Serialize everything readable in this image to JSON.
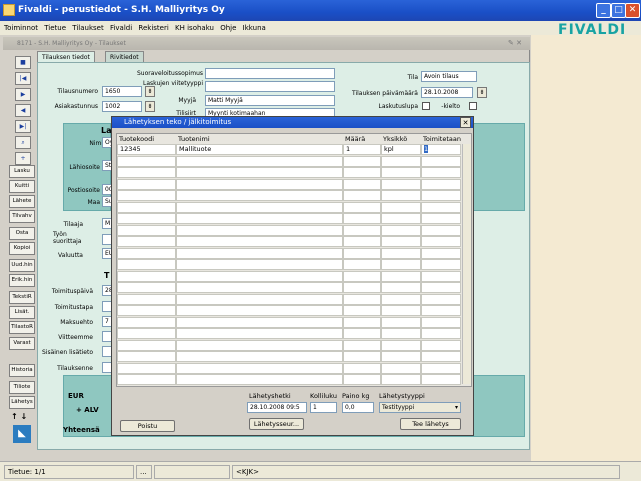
{
  "window": {
    "title": "Fivaldi - perustiedot - S.H. Malliyritys Oy"
  },
  "logo": "FIVALDI",
  "menu": [
    "Toiminnot",
    "Tietue",
    "Tilaukset",
    "Fivaldi",
    "Rekisteri",
    "KH isohaku",
    "Ohje",
    "Ikkuna"
  ],
  "inner_window": {
    "title": "8171 - S.H. Malliyritys Oy - Tilaukset"
  },
  "tabs": [
    "Tilauksen tiedot",
    "Rivitiedot"
  ],
  "side_buttons": [
    "Lasku",
    "Kuitti",
    "Lähete",
    "Tilvahv",
    "Osta",
    "Kopioi",
    "Uud.hin",
    "Erik.hin",
    "TekstiR",
    "Lisät.",
    "TilastoR",
    "Varast",
    "Historia",
    "Tiliote",
    "Lähetys"
  ],
  "form": {
    "suoraveloitussopimus_label": "Suoraveloitussopimus",
    "laskujen_viitetyyppi_label": "Laskujen viitetyyppi",
    "myyja_label": "Myyjä",
    "myyja_value": "Matti Myyjä",
    "tilisiirt_label": "Tilisiirt",
    "tilisiirt_value": "Myynti kotimaahan",
    "tilausnumero_label": "Tilausnumero",
    "tilausnumero_value": "1650",
    "asiakastunnus_label": "Asiakastunnus",
    "asiakastunnus_value": "1002",
    "tila_label": "Tila",
    "tila_value": "Avoin tilaus",
    "tilauksen_pvm_label": "Tilauksen päivämäärä",
    "tilauksen_pvm_value": "28.10.2008",
    "laskutuslupa_label": "Laskutuslupa",
    "kielto_label": "-kielto",
    "nimi_label": "Nimi",
    "nimi_value": "Oy",
    "lahiosoite_label": "Lähiosoite",
    "lahiosoite_value": "St",
    "postiosoite_label": "Postiosoite",
    "postiosoite_value": "00",
    "maa_label": "Maa",
    "maa_value": "Su",
    "section_l": "La",
    "tilaaja_label": "Tilaaja",
    "tilaaja_value": "M",
    "tyon_suorittaja_label": "Työn suorittaja",
    "valuutta_label": "Valuutta",
    "valuutta_value": "EU",
    "section_t": "T",
    "toimituspaiva_label": "Toimituspäivä",
    "toimituspaiva_value": "28",
    "toimitustapa_label": "Toimitustapa",
    "maksuehto_label": "Maksuehto",
    "maksuehto_value": "7",
    "viitteemme_label": "Viitteemme",
    "sisainen_lisatieto_label": "Sisäinen lisätieto",
    "tilauksenne_label": "Tilauksenne",
    "eur_label": "EUR",
    "alv_label": "+ ALV",
    "yhteensa_label": "Yhteensä"
  },
  "dialog": {
    "title": "Lähetyksen teko / jälkitoimitus",
    "columns": [
      "Tuotekoodi",
      "Tuotenimi",
      "Määrä",
      "Yksikkö",
      "Toimitetaan"
    ],
    "rows": [
      {
        "tuotekoodi": "12345",
        "tuotenimi": "Mallituote",
        "maara": "1",
        "yksikko": "kpl",
        "toimitetaan": "1"
      }
    ],
    "lahetyshetki_label": "Lähetyshetki",
    "lahetyshetki_value": "28.10.2008 09:5",
    "kollikuku_label": "Kolliluku",
    "kollikuku_value": "1",
    "paino_label": "Paino kg",
    "paino_value": "0,0",
    "lahetystyyppi_label": "Lähetystyyppi",
    "lahetystyyppi_value": "Testityyppi",
    "poistu_label": "Poistu",
    "lahetysseur_label": "Lähetysseur...",
    "tee_lahetys_label": "Tee lähetys"
  },
  "status": {
    "record": "Tietue: 1/1",
    "ellipsis": "...",
    "mode": "<KJK>"
  }
}
